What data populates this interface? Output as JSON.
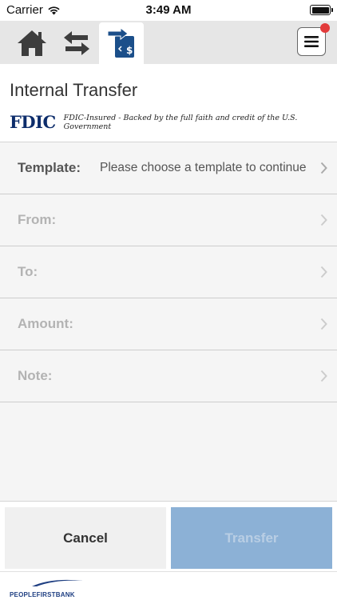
{
  "status_bar": {
    "carrier": "Carrier",
    "time": "3:49 AM"
  },
  "tabs": [
    {
      "icon": "home-icon"
    },
    {
      "icon": "transfer-arrows-icon"
    },
    {
      "icon": "internal-transfer-icon"
    }
  ],
  "header": {
    "title": "Internal Transfer",
    "fdic_logo": "FDIC",
    "fdic_text": "FDIC-Insured - Backed by the full faith and credit of the U.S. Government"
  },
  "form": {
    "template_label": "Template:",
    "template_value": "Please choose a template to continue",
    "from_label": "From:",
    "to_label": "To:",
    "amount_label": "Amount:",
    "note_label": "Note:"
  },
  "buttons": {
    "cancel": "Cancel",
    "transfer": "Transfer"
  },
  "footer": {
    "bank_name": "PEOPLEFIRSTBANK"
  },
  "colors": {
    "accent": "#1b4f8a",
    "transfer_disabled": "#8cb1d6",
    "badge": "#e23b3b",
    "fdic_blue": "#0d2d6b"
  }
}
